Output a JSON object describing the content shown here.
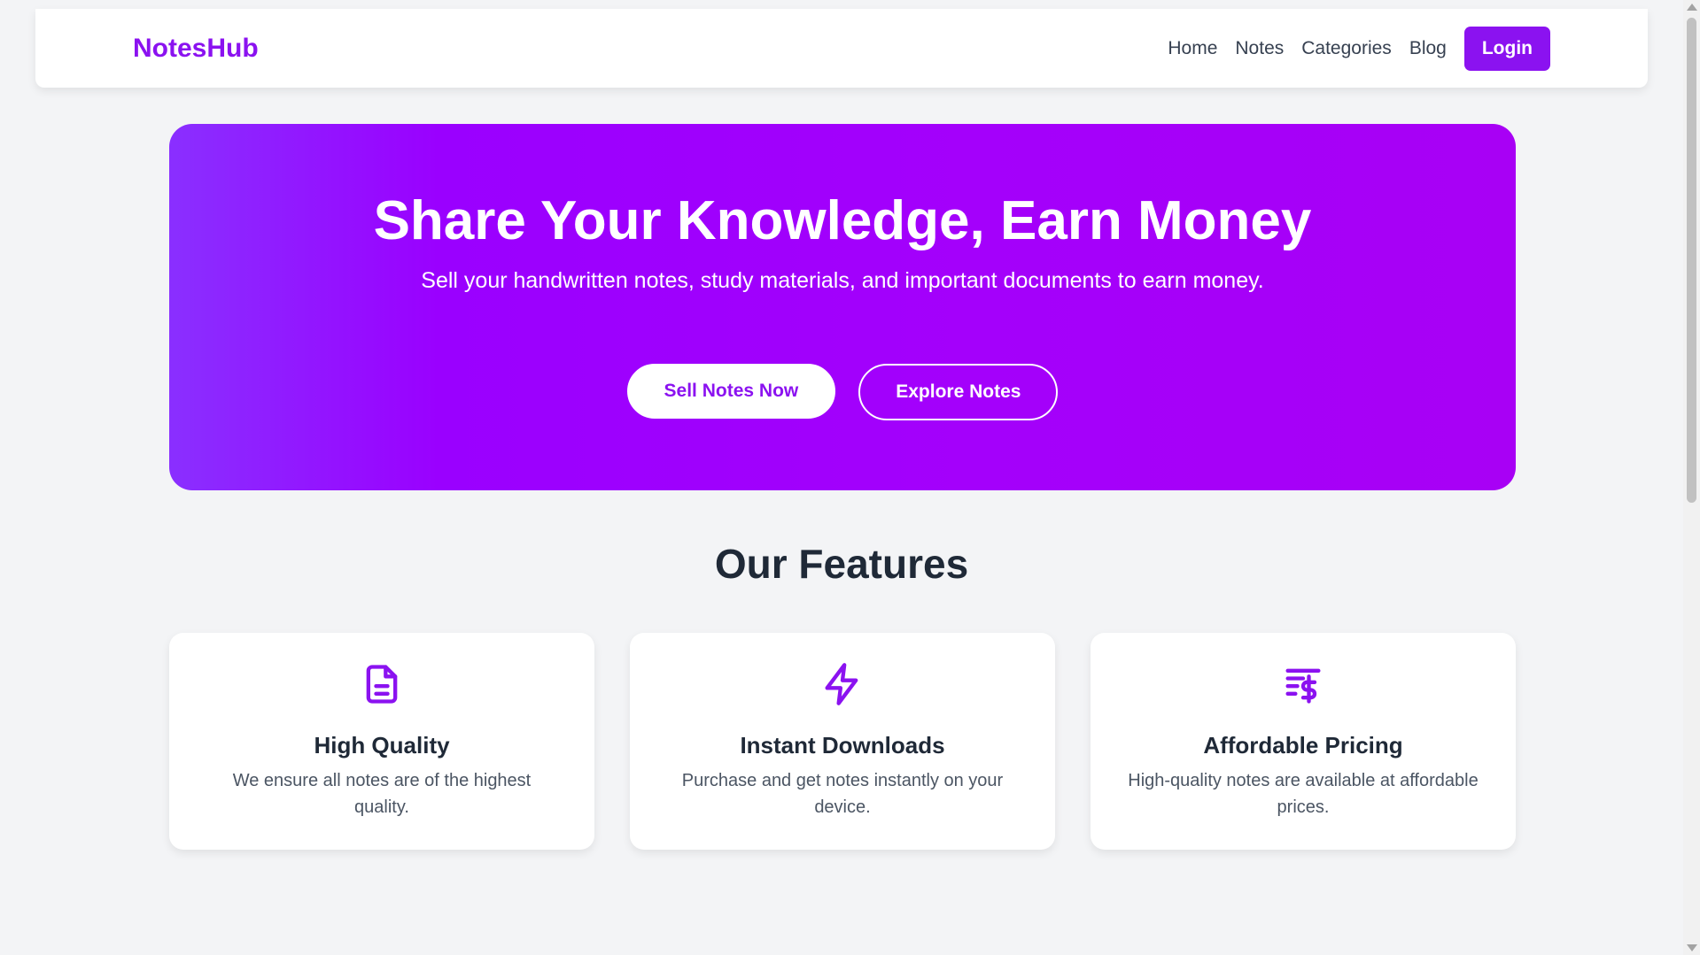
{
  "colors": {
    "accent": "#8b12f0",
    "background": "#f3f4f6",
    "card": "#ffffff"
  },
  "navbar": {
    "brand": "NotesHub",
    "links": [
      "Home",
      "Notes",
      "Categories",
      "Blog"
    ],
    "login_label": "Login"
  },
  "hero": {
    "title": "Share Your Knowledge, Earn Money",
    "subtitle": "Sell your handwritten notes, study materials, and important documents to earn money.",
    "primary_button": "Sell Notes Now",
    "secondary_button": "Explore Notes"
  },
  "features": {
    "title": "Our Features",
    "cards": [
      {
        "icon": "document-icon",
        "title": "High Quality",
        "description": "We ensure all notes are of the highest quality."
      },
      {
        "icon": "lightning-icon",
        "title": "Instant Downloads",
        "description": "Purchase and get notes instantly on your device."
      },
      {
        "icon": "pricing-icon",
        "title": "Affordable Pricing",
        "description": "High-quality notes are available at affordable prices."
      }
    ]
  }
}
